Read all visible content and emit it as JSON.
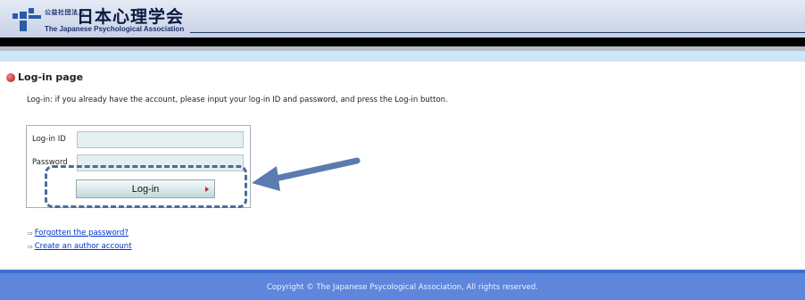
{
  "header": {
    "org_small": "公益社団法人",
    "org_name": "日本心理学会",
    "org_english": "The Japanese Psychological Association"
  },
  "page": {
    "title": "Log-in page",
    "instruction": "Log-in: if you already have the account, please input your log-in ID and password, and press the Log-in button."
  },
  "login_form": {
    "id_label": "Log-in ID",
    "id_value": "",
    "password_label": "Password",
    "password_value": "",
    "button_label": "Log-in"
  },
  "links": {
    "forgot_password": "Forgotten the password?",
    "create_account": "Create an author account"
  },
  "footer": {
    "copyright": "Copyright © The Japanese Psycological Association, All rights reserved."
  },
  "colors": {
    "header_bg": "#c7d1e6",
    "footer_bg": "#5d86dc",
    "annotation": "#4a6d9a",
    "link": "#0033cc"
  }
}
